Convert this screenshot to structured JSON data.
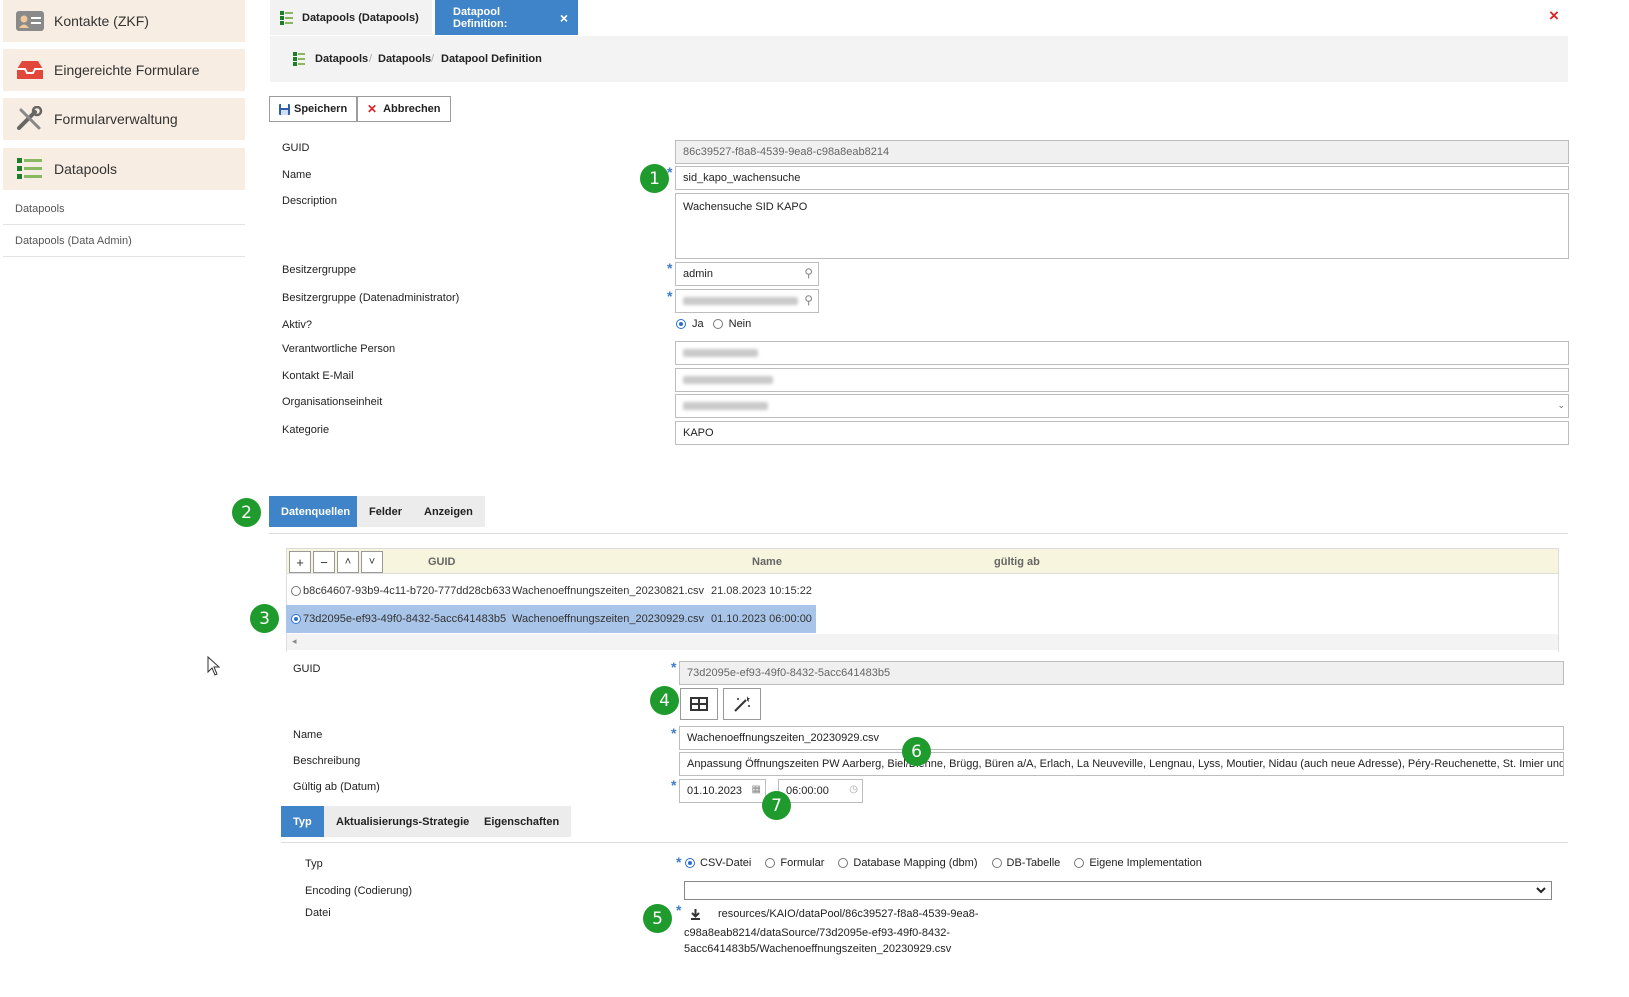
{
  "sidebar": {
    "items": [
      {
        "label": "Kontakte (ZKF)",
        "icon": "contact-card-icon"
      },
      {
        "label": "Eingereichte Formulare",
        "icon": "inbox-tray-icon"
      },
      {
        "label": "Formularverwaltung",
        "icon": "tools-icon"
      },
      {
        "label": "Datapools",
        "icon": "list-icon"
      }
    ],
    "subitems": [
      "Datapools",
      "Datapools (Data Admin)"
    ]
  },
  "tabs": {
    "first": "Datapools (Datapools)",
    "second": "Datapool Definition:",
    "close": "×",
    "window_close": "×"
  },
  "breadcrumb": [
    "Datapools",
    "Datapools",
    "Datapool Definition"
  ],
  "breadcrumb_sep": "/",
  "toolbar": {
    "save": "Speichern",
    "cancel": "Abbrechen"
  },
  "form": {
    "guid_label": "GUID",
    "guid_value": "86c39527-f8a8-4539-9ea8-c98a8eab8214",
    "name_label": "Name",
    "name_value": "sid_kapo_wachensuche",
    "description_label": "Description",
    "description_value": "Wachensuche SID KAPO",
    "owner_label": "Besitzergruppe",
    "owner_value": "admin",
    "owner_admin_label": "Besitzergruppe (Datenadministrator)",
    "active_label": "Aktiv?",
    "active_yes": "Ja",
    "active_no": "Nein",
    "responsible_label": "Verantwortliche Person",
    "email_label": "Kontakt E-Mail",
    "orgunit_label": "Organisationseinheit",
    "category_label": "Kategorie",
    "category_value": "KAPO"
  },
  "section_tabs": [
    "Datenquellen",
    "Felder",
    "Anzeigen"
  ],
  "grid": {
    "buttons": [
      "+",
      "−",
      "˄",
      "˅"
    ],
    "columns": [
      "GUID",
      "Name",
      "gültig ab"
    ],
    "rows": [
      {
        "guid": "b8c64607-93b9-4c11-b720-777dd28cb633",
        "name": "Wachenoeffnungszeiten_20230821.csv",
        "valid": "21.08.2023 10:15:22",
        "selected": false
      },
      {
        "guid": "73d2095e-ef93-49f0-8432-5acc641483b5",
        "name": "Wachenoeffnungszeiten_20230929.csv",
        "valid": "01.10.2023 06:00:00",
        "selected": true
      }
    ],
    "scroll_left": "◂"
  },
  "detail": {
    "guid_label": "GUID",
    "guid_value": "73d2095e-ef93-49f0-8432-5acc641483b5",
    "name_label": "Name",
    "name_value": "Wachenoeffnungszeiten_20230929.csv",
    "desc_label": "Beschreibung",
    "desc_value": "Anpassung Öffnungszeiten PW Aarberg, Biel/Bienne, Brügg, Büren a/A, Erlach, La Neuveville, Lengnau, Lyss, Moutier, Nidau (auch neue Adresse), Péry-Reuchenette, St. Imier und Tavan",
    "valid_label": "Gültig ab (Datum)",
    "valid_date": "01.10.2023",
    "valid_time": "06:00:00"
  },
  "sub_tabs": [
    "Typ",
    "Aktualisierungs-Strategie",
    "Eigenschaften"
  ],
  "typ": {
    "type_label": "Typ",
    "options": [
      "CSV-Datei",
      "Formular",
      "Database Mapping (dbm)",
      "DB-Tabelle",
      "Eigene Implementation"
    ],
    "encoding_label": "Encoding (Codierung)",
    "file_label": "Datei",
    "file_path_1": "resources/KAIO/dataPool/86c39527-f8a8-4539-9ea8-",
    "file_path_2": "c98a8eab8214/dataSource/73d2095e-ef93-49f0-8432-",
    "file_path_3": "5acc641483b5/Wachenoeffnungszeiten_20230929.csv"
  },
  "markers": [
    "1",
    "2",
    "3",
    "4",
    "5",
    "6",
    "7"
  ],
  "colors": {
    "accent": "#3f84c8",
    "marker": "#1f9a2c",
    "sidebar_bg": "#f7ede2",
    "close": "#d9262a"
  }
}
